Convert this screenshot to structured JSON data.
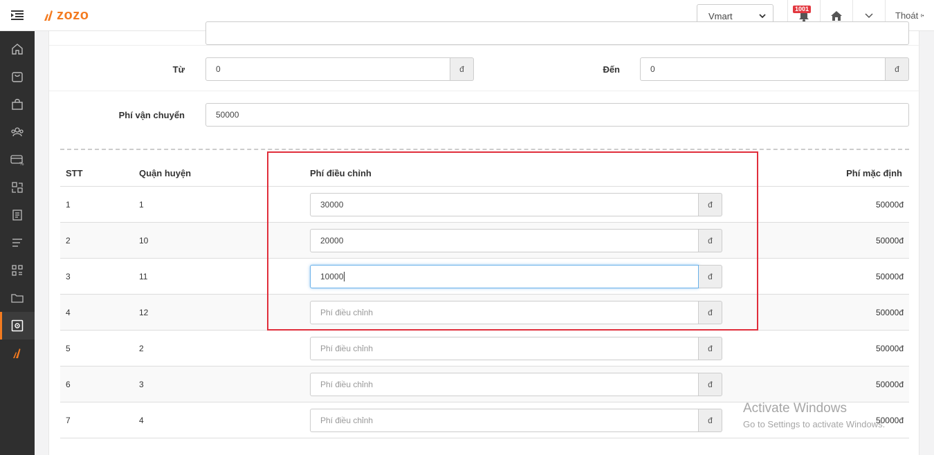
{
  "header": {
    "logo_text": "zozo",
    "store_selected": "Vmart",
    "notification_count": "1001",
    "logout_label": "Thoát"
  },
  "sidebar": {
    "items": [
      {
        "icon": "home-icon"
      },
      {
        "icon": "bag-icon"
      },
      {
        "icon": "shopping-bag-icon"
      },
      {
        "icon": "users-icon"
      },
      {
        "icon": "payment-icon"
      },
      {
        "icon": "transfer-icon"
      },
      {
        "icon": "document-icon"
      },
      {
        "icon": "list-icon"
      },
      {
        "icon": "grid-icon"
      },
      {
        "icon": "folder-icon"
      },
      {
        "icon": "settings-icon",
        "active": true
      },
      {
        "icon": "brand-icon"
      }
    ]
  },
  "form": {
    "from_label": "Từ",
    "from_value": "0",
    "from_unit": "đ",
    "to_label": "Đến",
    "to_value": "0",
    "to_unit": "đ",
    "shipping_label": "Phí vận chuyển",
    "shipping_value": "50000"
  },
  "table": {
    "headers": {
      "stt": "STT",
      "district": "Quận huyện",
      "adjusted_fee": "Phí điều chỉnh",
      "default_fee": "Phí mặc định"
    },
    "placeholder": "Phí điều chỉnh",
    "unit": "đ",
    "rows": [
      {
        "stt": "1",
        "district": "1",
        "adjusted": "30000",
        "default": "50000đ"
      },
      {
        "stt": "2",
        "district": "10",
        "adjusted": "20000",
        "default": "50000đ"
      },
      {
        "stt": "3",
        "district": "11",
        "adjusted": "10000",
        "default": "50000đ"
      },
      {
        "stt": "4",
        "district": "12",
        "adjusted": "",
        "default": "50000đ"
      },
      {
        "stt": "5",
        "district": "2",
        "adjusted": "",
        "default": "50000đ"
      },
      {
        "stt": "6",
        "district": "3",
        "adjusted": "",
        "default": "50000đ"
      },
      {
        "stt": "7",
        "district": "4",
        "adjusted": "",
        "default": "50000đ"
      }
    ]
  },
  "watermark": {
    "line1": "Activate Windows",
    "line2": "Go to Settings to activate Windows."
  },
  "colors": {
    "accent": "#f47b20",
    "highlight": "#e02d3a",
    "sidebar_bg": "#2f2f2f"
  }
}
